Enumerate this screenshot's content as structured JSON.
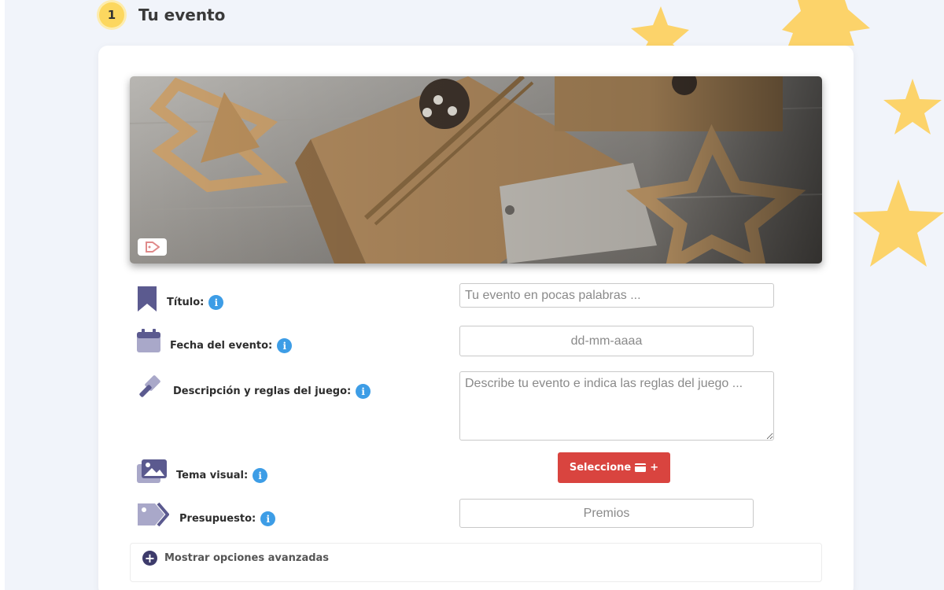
{
  "step": {
    "number": "1",
    "title": "Tu evento"
  },
  "form": {
    "titulo": {
      "label": "Título:",
      "placeholder": "Tu evento en pocas palabras ..."
    },
    "fecha": {
      "label": "Fecha del evento:",
      "placeholder": "dd-mm-aaaa"
    },
    "descripcion": {
      "label": "Descripción y reglas del juego:",
      "placeholder": "Describe tu evento e indica las reglas del juego ..."
    },
    "tema": {
      "label": "Tema visual:",
      "button_label": "Seleccione",
      "button_suffix": "+"
    },
    "presupuesto": {
      "label": "Presupuesto:",
      "placeholder": "Premios"
    },
    "info_glyph": "i"
  },
  "advanced": {
    "label": "Mostrar opciones avanzadas",
    "icon_glyph": "+"
  },
  "colors": {
    "accent": "#d9443f",
    "info": "#3d9de6",
    "icon": "#5b5a8f",
    "star": "#fcd36a"
  }
}
